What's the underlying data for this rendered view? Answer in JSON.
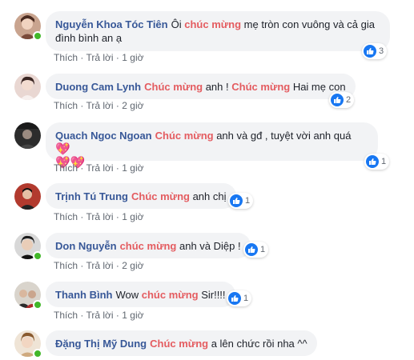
{
  "colors": {
    "author": "#385898",
    "highlight": "#e45c60",
    "like": "#1877f2",
    "bubble": "#f2f3f5"
  },
  "actions": {
    "like": "Thích",
    "reply": "Trả lời",
    "sep": "·"
  },
  "comments": [
    {
      "author": "Nguyễn Khoa Tóc Tiên",
      "segments": [
        {
          "t": "Ôi ",
          "hl": false
        },
        {
          "t": "chúc mừng",
          "hl": true
        },
        {
          "t": " mẹ tròn con vuông và cả gia đình bình an ạ",
          "hl": false
        }
      ],
      "time": "1 giờ",
      "likes": "3",
      "online": true
    },
    {
      "author": "Duong Cam Lynh",
      "segments": [
        {
          "t": "Chúc mừng",
          "hl": true
        },
        {
          "t": " anh ! ",
          "hl": false
        },
        {
          "t": "Chúc mừng",
          "hl": true
        },
        {
          "t": " Hai mẹ con",
          "hl": false
        }
      ],
      "time": "2 giờ",
      "likes": "2",
      "online": false
    },
    {
      "author": "Quach Ngoc Ngoan",
      "segments": [
        {
          "t": "Chúc mừng",
          "hl": true
        },
        {
          "t": " anh và gđ , tuyệt vời anh quá ",
          "hl": false
        }
      ],
      "time": "1 giờ",
      "likes": "1",
      "online": false
    },
    {
      "author": "Trịnh Tú Trung",
      "segments": [
        {
          "t": "Chúc mừng",
          "hl": true
        },
        {
          "t": " anh chị",
          "hl": false
        }
      ],
      "time": "1 giờ",
      "likes": "1",
      "online": false
    },
    {
      "author": "Don Nguyễn",
      "segments": [
        {
          "t": "chúc mừng",
          "hl": true
        },
        {
          "t": " anh và Diệp !",
          "hl": false
        }
      ],
      "time": "2 giờ",
      "likes": "1",
      "online": true
    },
    {
      "author": "Thanh Bình",
      "segments": [
        {
          "t": "Wow ",
          "hl": false
        },
        {
          "t": "chúc mừng",
          "hl": true
        },
        {
          "t": " Sir!!!!",
          "hl": false
        }
      ],
      "time": "1 giờ",
      "likes": "1",
      "online": true
    },
    {
      "author": "Đặng Thị Mỹ Dung",
      "segments": [
        {
          "t": "Chúc mừng",
          "hl": true
        },
        {
          "t": " a lên chức rồi nha ^^",
          "hl": false
        }
      ],
      "time": "",
      "likes": "",
      "online": true
    }
  ]
}
